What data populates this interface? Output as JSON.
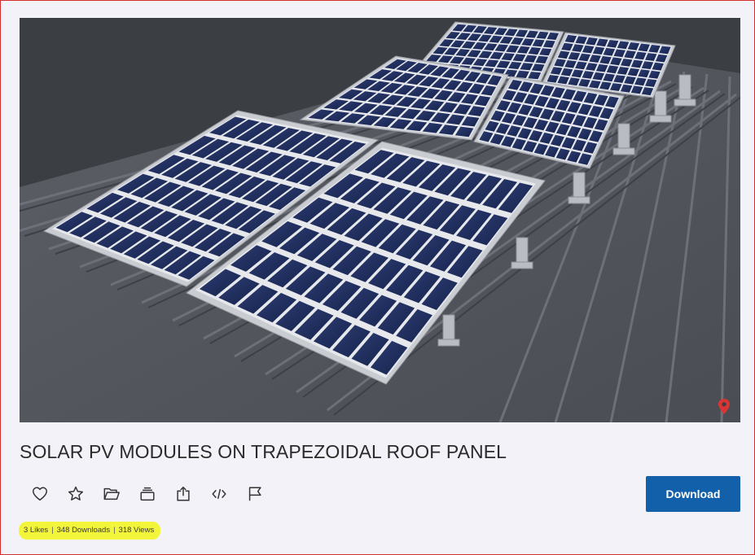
{
  "model": {
    "title": "SOLAR PV MODULES ON TRAPEZOIDAL ROOF PANEL"
  },
  "actions": [
    {
      "name": "like-icon"
    },
    {
      "name": "favorite-star-icon"
    },
    {
      "name": "add-to-folder-icon"
    },
    {
      "name": "collections-icon"
    },
    {
      "name": "share-icon"
    },
    {
      "name": "embed-code-icon"
    },
    {
      "name": "report-flag-icon"
    }
  ],
  "download": {
    "label": "Download",
    "color": "#1160a9"
  },
  "stats": {
    "likes": "3 Likes",
    "downloads": "348 Downloads",
    "views": "318 Views",
    "separator": "|",
    "highlight_color": "#f2f53a"
  },
  "viewer": {
    "pin_icon": "location-pin-icon",
    "pin_color": "#d93535"
  }
}
